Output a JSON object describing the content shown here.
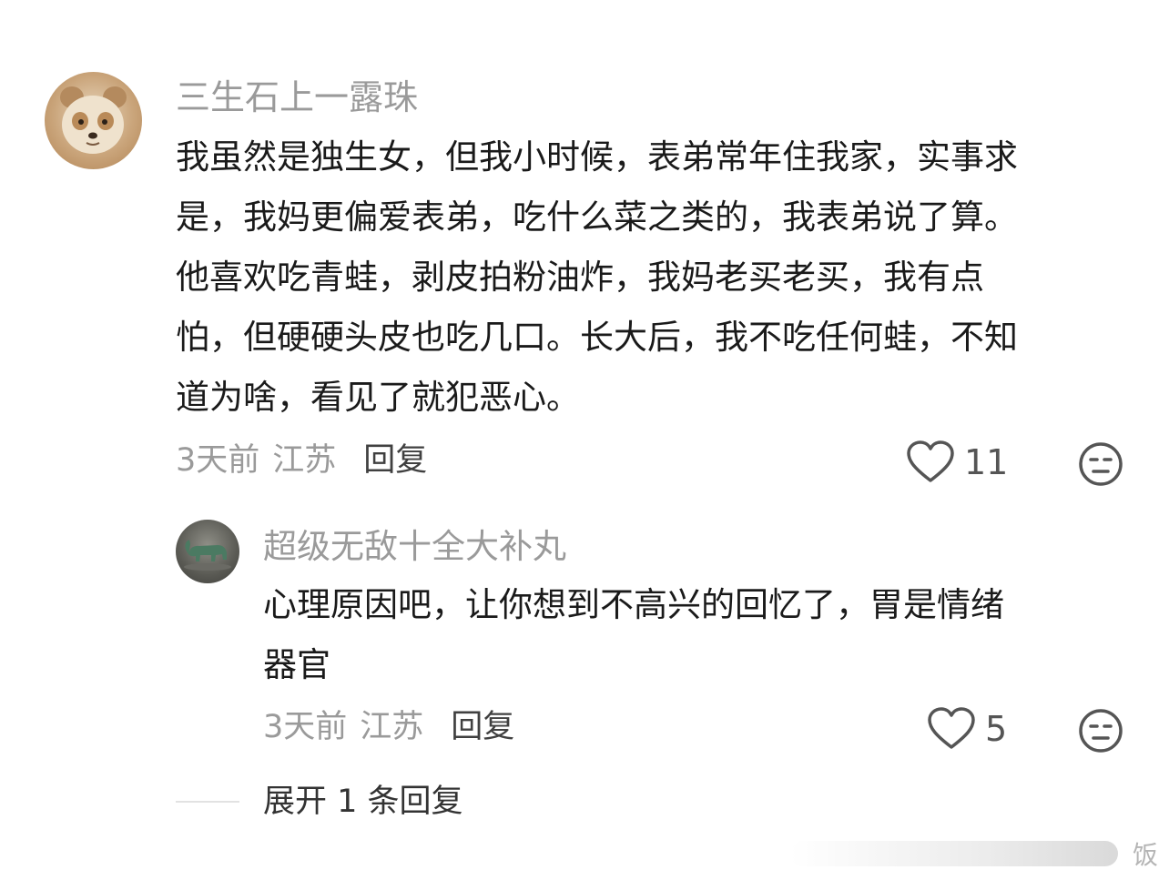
{
  "main_comment": {
    "username": "三生石上一露珠",
    "avatar_icon": "panda-avatar",
    "text_lines": [
      "我虽然是独生女，但我小时候，表弟常年住我家，实事求",
      "是，我妈更偏爱表弟，吃什么菜之类的，我表弟说了算。",
      "他喜欢吃青蛙，剥皮拍粉油炸，我妈老买老买，我有点",
      "怕，但硬硬头皮也吃几口。长大后，我不吃任何蛙，不知",
      "道为啥，看见了就犯恶心。"
    ],
    "time": "3天前",
    "location": "江苏",
    "reply_label": "回复",
    "like_count": "11"
  },
  "reply_comment": {
    "username": "超级无敌十全大补丸",
    "avatar_icon": "bronze-animal-avatar",
    "text_lines": [
      "心理原因吧，让你想到不高兴的回忆了，胃是情绪",
      "器官"
    ],
    "time": "3天前",
    "location": "江苏",
    "reply_label": "回复",
    "like_count": "5"
  },
  "expand": {
    "label": "展开 1 条回复"
  },
  "watermark": {
    "text": "饭"
  },
  "colors": {
    "username": "#9a9a9a",
    "body_text": "#1a1a1a",
    "meta": "#9a9a9a",
    "icon": "#555555"
  }
}
